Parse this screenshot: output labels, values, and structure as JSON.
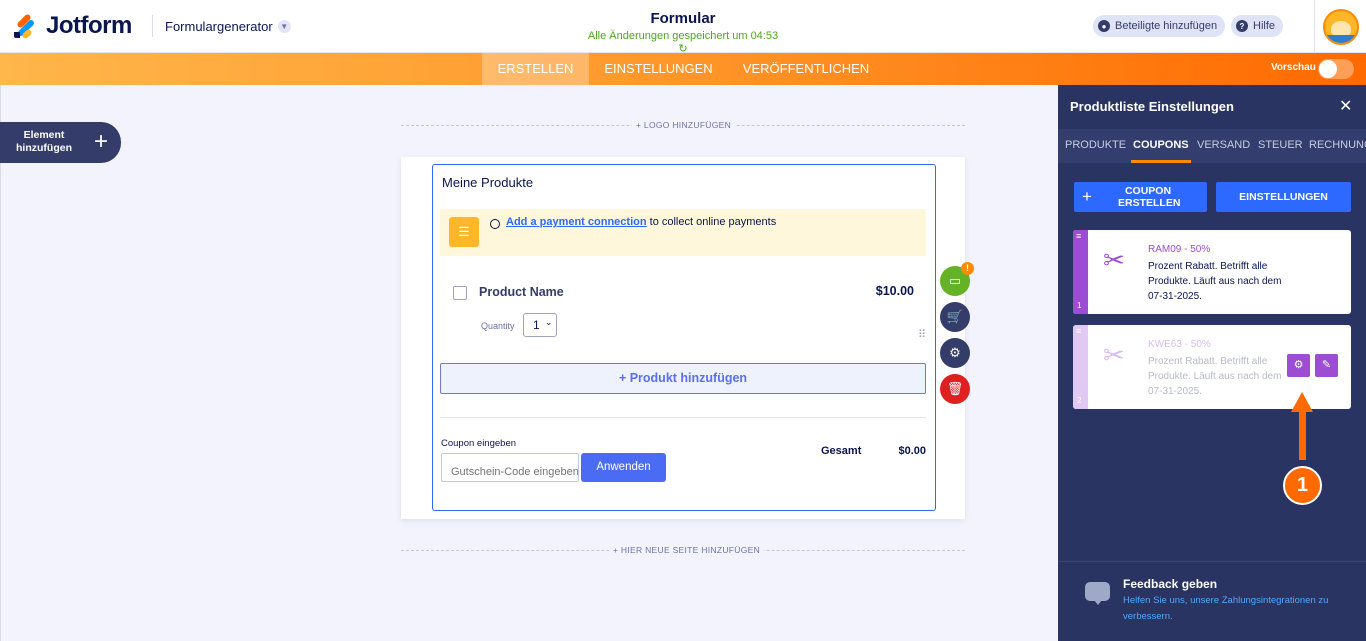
{
  "header": {
    "logo_text": "Jotform",
    "builder_label": "Formulargenerator",
    "form_title": "Formular",
    "saved_status": "Alle Änderungen gespeichert um 04:53 ↻",
    "add_participants": "Beteiligte hinzufügen",
    "help": "Hilfe"
  },
  "nav": {
    "tabs": [
      "ERSTELLEN",
      "EINSTELLUNGEN",
      "VERÖFFENTLICHEN"
    ],
    "active_tab": "ERSTELLEN",
    "preview_label": "Vorschau"
  },
  "sidebar": {
    "add_element_label": "Element hinzufügen",
    "add_icon": "+"
  },
  "canvas": {
    "add_logo": "+ LOGO HINZUFÜGEN",
    "add_page": "+ HIER NEUE SEITE HINZUFÜGEN",
    "products_heading": "Meine Produkte",
    "payment_link": "Add a payment connection",
    "payment_text": " to collect online payments",
    "product_name": "Product Name",
    "product_price": "$10.00",
    "quantity_label": "Quantity",
    "quantity_value": "1",
    "add_product": "+ Produkt hinzufügen",
    "coupon_label": "Coupon eingeben",
    "coupon_placeholder": "Gutschein-Code eingeben",
    "apply_button": "Anwenden",
    "total_label": "Gesamt",
    "total_value": "$0.00",
    "warning_badge": "!"
  },
  "panel": {
    "title": "Produktliste Einstellungen",
    "close": "✕",
    "tabs": [
      "PRODUKTE",
      "COUPONS",
      "VERSAND",
      "STEUER",
      "RECHNUNG"
    ],
    "active_tab": "COUPONS",
    "create_coupon": "COUPON ERSTELLEN",
    "settings_button": "EINSTELLUNGEN",
    "coupons": [
      {
        "number": "1",
        "code": "RAM09 - 50%",
        "description": "Prozent Rabatt. Betrifft alle Produkte. Läuft aus nach dem 07-31-2025."
      },
      {
        "number": "2",
        "code": "KWE63 - 50%",
        "description": "Prozent Rabatt. Betrifft alle Produkte. Läuft aus nach dem 07-31-2025."
      }
    ],
    "feedback_title": "Feedback geben",
    "feedback_text": "Helfen Sie uns, unsere Zahlungsintegrationen zu verbessern."
  },
  "annotation": {
    "step_number": "1"
  },
  "colors": {
    "brand_orange": "#ff6100",
    "accent_blue": "#2e69ff",
    "coupon_purple": "#9c4dd3",
    "panel_bg": "#293462"
  }
}
